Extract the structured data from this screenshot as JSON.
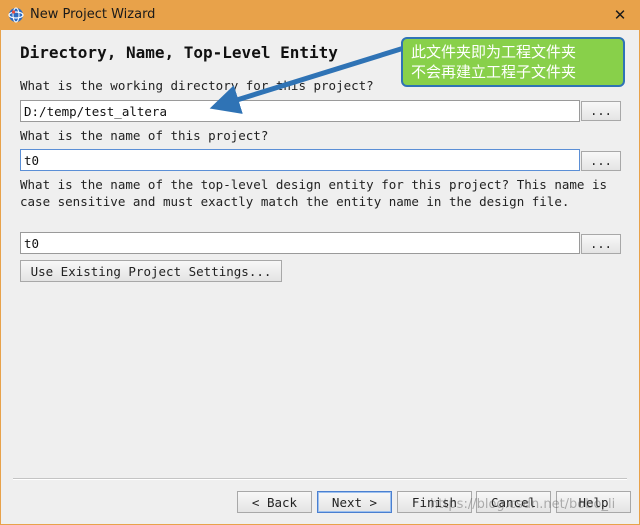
{
  "window": {
    "title": "New Project Wizard",
    "close_glyph": "✕",
    "icon": "quartus-globe-icon"
  },
  "page": {
    "title": "Directory, Name, Top-Level Entity"
  },
  "fields": {
    "directory": {
      "question": "What is the working directory for this project?",
      "value": "D:/temp/test_altera",
      "browse_label": "..."
    },
    "project_name": {
      "question": "What is the name of this project?",
      "value": "t0",
      "browse_label": "..."
    },
    "top_level": {
      "question": "What is the name of the top-level design entity for this project? This name is case sensitive and must exactly match the entity name in the design file.",
      "value": "t0",
      "browse_label": "..."
    }
  },
  "use_existing_label": "Use Existing Project Settings...",
  "nav": {
    "back": "< Back",
    "next": "Next >",
    "finish": "Finish",
    "cancel": "Cancel",
    "help": "Help"
  },
  "annotation": {
    "line1": "此文件夹即为工程文件夹",
    "line2": "不会再建立工程子文件夹"
  },
  "watermark": "https://blog.csdn.net/bobo_li",
  "colors": {
    "titlebar": "#e8a24a",
    "callout_fill": "#88d04a",
    "callout_border": "#2f73b5",
    "arrow": "#2f73b5",
    "focus_border": "#5b8fd6"
  }
}
